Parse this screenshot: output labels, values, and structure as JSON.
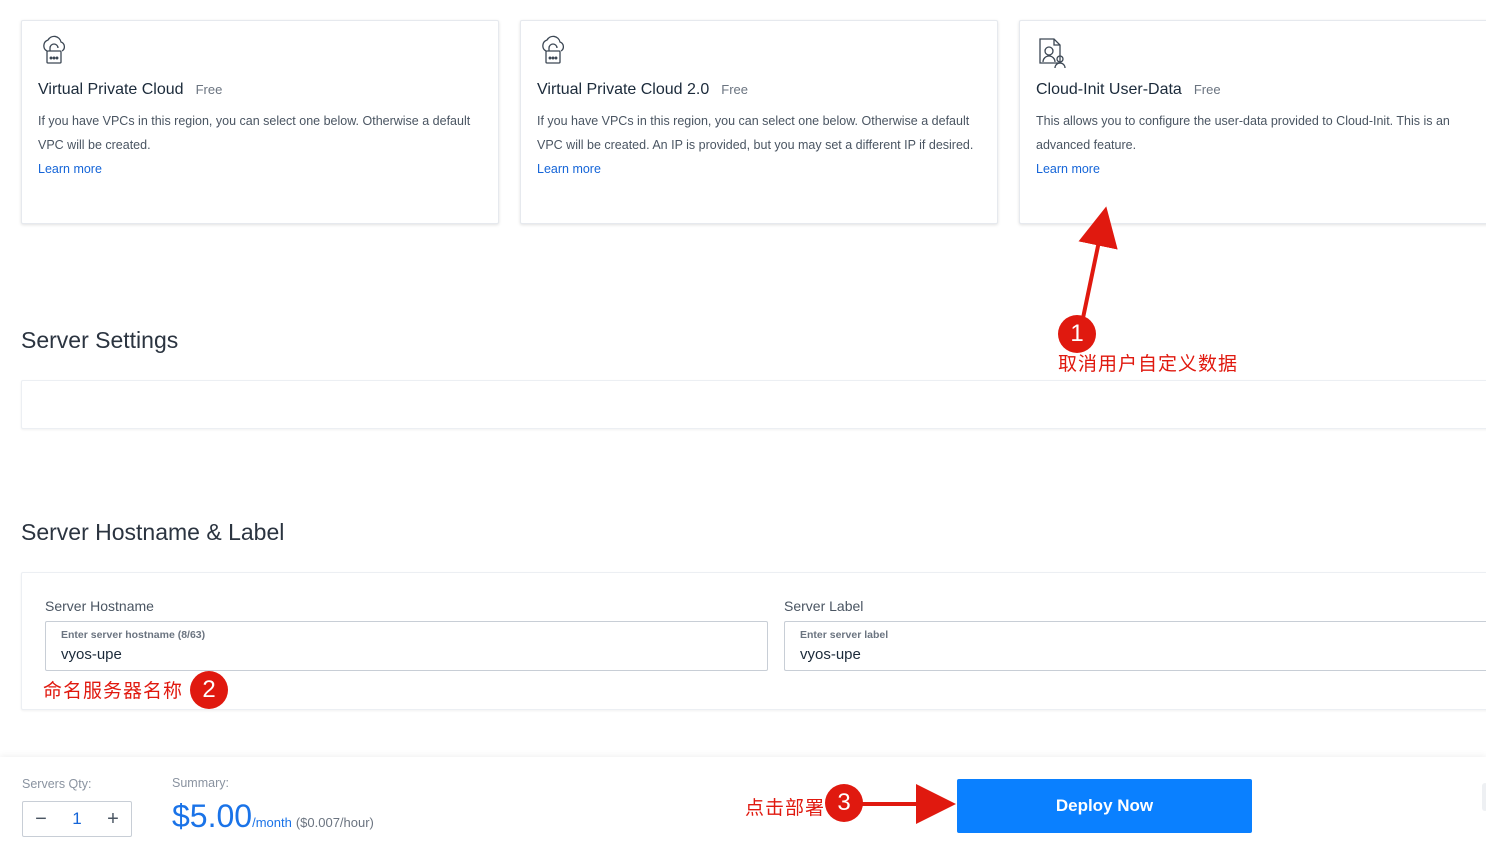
{
  "cards": [
    {
      "title": "Virtual Private Cloud",
      "price": "Free",
      "description": "If you have VPCs in this region, you can select one below. Otherwise a default VPC will be created.",
      "link": "Learn more",
      "icon": "cloud-lock-icon"
    },
    {
      "title": "Virtual Private Cloud 2.0",
      "price": "Free",
      "description": "If you have VPCs in this region, you can select one below. Otherwise a default VPC will be created. An IP is provided, but you may set a different IP if desired.",
      "link": "Learn more",
      "icon": "cloud-lock-icon"
    },
    {
      "title": "Cloud-Init User-Data",
      "price": "Free",
      "description": "This allows you to configure the user-data provided to Cloud-Init. This is an advanced feature.",
      "link": "Learn more",
      "icon": "document-user-icon"
    }
  ],
  "server_settings": {
    "title": "Server Settings"
  },
  "hostname_section": {
    "title": "Server Hostname & Label",
    "hostname": {
      "label": "Server Hostname",
      "hint": "Enter server hostname (8/63)",
      "value": "vyos-upe"
    },
    "server_label": {
      "label": "Server Label",
      "hint": "Enter server label",
      "value": "vyos-upe"
    }
  },
  "footer": {
    "qty_label": "Servers Qty:",
    "qty_minus": "−",
    "qty_value": "1",
    "qty_plus": "+",
    "summary_label": "Summary:",
    "price": "$5.00",
    "per_month": "/month",
    "per_hour": "($0.007/hour)",
    "deploy_label": "Deploy Now"
  },
  "annotations": {
    "one_num": "1",
    "one_text": "取消用户自定义数据",
    "two_num": "2",
    "two_text": "命名服务器名称",
    "three_num": "3",
    "three_text": "点击部署",
    "color": "#e0190f"
  },
  "colors": {
    "accent": "#0a80ff",
    "link": "#1565d8",
    "price": "#1a73e8"
  }
}
